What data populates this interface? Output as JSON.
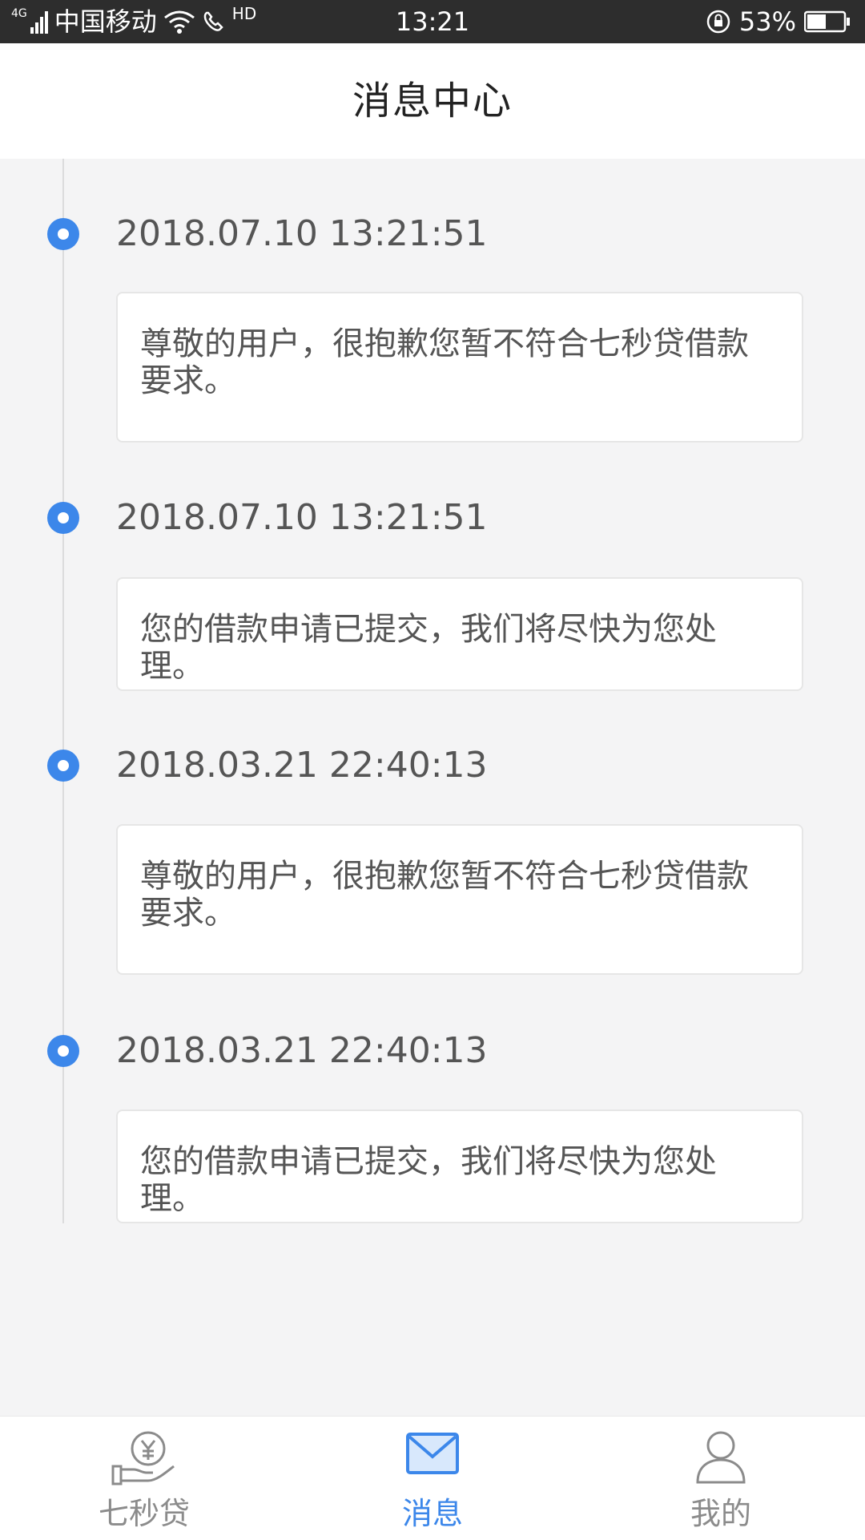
{
  "status_bar": {
    "network_type": "4G",
    "carrier": "中国移动",
    "hd_badge": "HD",
    "time": "13:21",
    "battery_percent": "53%",
    "battery_level": 0.53
  },
  "header": {
    "title": "消息中心"
  },
  "messages": [
    {
      "timestamp": "2018.07.10 13:21:51",
      "text": "尊敬的用户，很抱歉您暂不符合七秒贷借款要求。"
    },
    {
      "timestamp": "2018.07.10 13:21:51",
      "text": "您的借款申请已提交，我们将尽快为您处理。"
    },
    {
      "timestamp": "2018.03.21 22:40:13",
      "text": "尊敬的用户，很抱歉您暂不符合七秒贷借款要求。"
    },
    {
      "timestamp": "2018.03.21 22:40:13",
      "text": "您的借款申请已提交，我们将尽快为您处理。"
    }
  ],
  "bottom_nav": {
    "items": [
      {
        "label": "七秒贷",
        "icon": "loan-hand-coin-icon",
        "active": false
      },
      {
        "label": "消息",
        "icon": "envelope-icon",
        "active": true
      },
      {
        "label": "我的",
        "icon": "user-icon",
        "active": false
      }
    ]
  },
  "colors": {
    "accent": "#3c87ea",
    "status_bar": "#2d2d2d",
    "background": "#f4f4f5",
    "inactive": "#8b8b8b"
  }
}
